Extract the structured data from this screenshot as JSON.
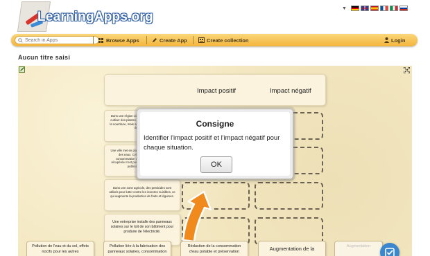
{
  "header": {
    "logo_text": "LearningApps.org",
    "language_flags": [
      "de-flag",
      "en-flag",
      "es-flag",
      "fr-flag",
      "it-flag",
      "ru-flag"
    ]
  },
  "nav": {
    "search_placeholder": "Search in Apps",
    "browse": "Browse Apps",
    "create_app": "Create App",
    "create_collection": "Create collection",
    "login": "Login"
  },
  "page": {
    "title": "Aucun titre saisi"
  },
  "app": {
    "columns": [
      "Impact positif",
      "Impact négatif"
    ],
    "situations": [
      "Dans une région où l'on utilise les cultures pour cultiver des plantes. Cela permet de produire de la nourriture, mais aussi de réduire les émissions de carbone.",
      "Une ville met en place un système de recyclage des eaux. Cela permet de réduire la consommation d'eau potable, mais l'eau récupérée n'est pas adaptée à tous les usages publics pour l'hygiène.",
      "Dans une zone agricole, des pesticides sont utilisés pour lutter contre les insectes nuisibles, ce qui augmente la production de fruits et légumes.",
      "Une entreprise installe des panneaux solaires sur le toit de son bâtiment pour produire de l'électricité."
    ],
    "bottom_cards": [
      "Pollution de l'eau et du sol, effets nocifs pour les autres",
      "Pollution liée à la fabrication des panneaux solaires, consommation",
      "Réduction de la consommation d'eau potable et préservation",
      "Augmentation de la",
      "Augmentation"
    ]
  },
  "modal": {
    "title": "Consigne",
    "text": "Identifier l'impact positif et l'impact négatif pour chaque situation.",
    "ok": "OK"
  },
  "colors": {
    "accent": "#f3b53b",
    "app_bg": "#f4e8c2",
    "check_button": "#3a87cf",
    "arrow": "#f08a1c"
  }
}
